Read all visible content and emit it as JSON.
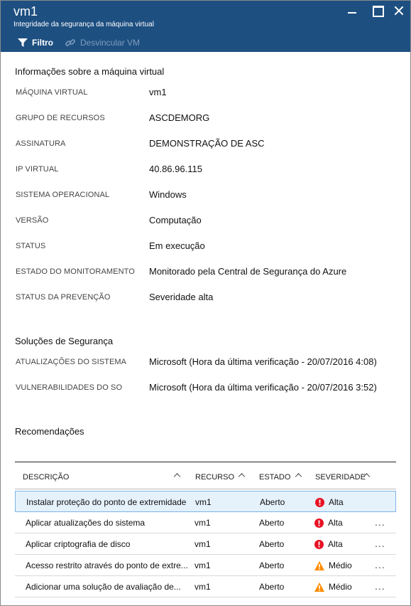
{
  "header": {
    "title": "vm1",
    "subtitle": "Integridade da segurança da máquina virtual"
  },
  "toolbar": {
    "filter_label": "Filtro",
    "unlink_label": "Desvincular VM"
  },
  "vm_info": {
    "section_title": "Informações sobre a máquina virtual",
    "rows": [
      {
        "label": "MÁQUINA VIRTUAL",
        "value": "vm1"
      },
      {
        "label": "GRUPO DE RECURSOS",
        "value": "ASCDEMORG"
      },
      {
        "label": "ASSINATURA",
        "value": "DEMONSTRAÇÃO DE ASC"
      },
      {
        "label": "IP VIRTUAL",
        "value": "40.86.96.115"
      },
      {
        "label": "SISTEMA OPERACIONAL",
        "value": "Windows"
      },
      {
        "label": "VERSÃO",
        "value": "Computação"
      },
      {
        "label": "STATUS",
        "value": "Em execução"
      },
      {
        "label": "ESTADO DO MONITORAMENTO",
        "value": "Monitorado pela Central de Segurança do Azure"
      },
      {
        "label": "STATUS DA PREVENÇÃO",
        "value": "Severidade alta"
      }
    ]
  },
  "security_solutions": {
    "section_title": "Soluções de Segurança",
    "rows": [
      {
        "label": "ATUALIZAÇÕES DO SISTEMA",
        "value": "Microsoft (Hora da última verificação - 20/07/2016 4:08)"
      },
      {
        "label": "VULNERABILIDADES DO SO",
        "value": "Microsoft (Hora da última verificação - 20/07/2016 3:52)"
      }
    ]
  },
  "recommendations": {
    "section_title": "Recomendações",
    "columns": [
      "DESCRIÇÃO",
      "RECURSO",
      "ESTADO",
      "SEVERIDADE"
    ],
    "rows": [
      {
        "description": "Instalar proteção do ponto de extremidade",
        "resource": "vm1",
        "state": "Aberto",
        "severity": "Alta",
        "level": "high"
      },
      {
        "description": "Aplicar atualizações do sistema",
        "resource": "vm1",
        "state": "Aberto",
        "severity": "Alta",
        "level": "high"
      },
      {
        "description": "Aplicar criptografia de disco",
        "resource": "vm1",
        "state": "Aberto",
        "severity": "Alta",
        "level": "high"
      },
      {
        "description": "Acesso restrito através do ponto de extre...",
        "resource": "vm1",
        "state": "Aberto",
        "severity": "Médio",
        "level": "medium"
      },
      {
        "description": "Adicionar uma solução de avaliação de...",
        "resource": "vm1",
        "state": "Aberto",
        "severity": "Médio",
        "level": "medium"
      }
    ],
    "more_label": "..."
  },
  "colors": {
    "header_bg": "#1e4f81",
    "high_severity": "#e81123",
    "medium_severity": "#ff8c00",
    "selected_row": "#e5f1fb"
  }
}
